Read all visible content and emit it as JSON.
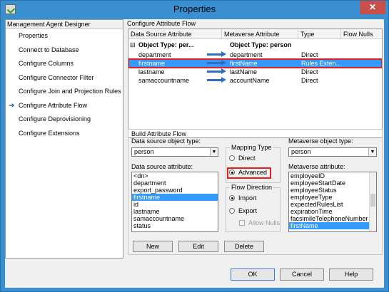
{
  "window": {
    "title": "Properties"
  },
  "nav": {
    "header": "Management Agent Designer",
    "items": [
      {
        "label": "Properties",
        "active": false
      },
      {
        "label": "Connect to Database",
        "active": false
      },
      {
        "label": "Configure Columns",
        "active": false
      },
      {
        "label": "Configure Connector Filter",
        "active": false
      },
      {
        "label": "Configure Join and Projection Rules",
        "active": false
      },
      {
        "label": "Configure Attribute Flow",
        "active": true
      },
      {
        "label": "Configure Deprovisioning",
        "active": false
      },
      {
        "label": "Configure Extensions",
        "active": false
      }
    ]
  },
  "section": {
    "title": "Configure Attribute Flow"
  },
  "grid": {
    "columns": [
      "Data Source Attribute",
      "Metaverse Attribute",
      "Type",
      "Flow Nulls"
    ],
    "group_toggle": "⊟",
    "group_left": "Object Type: per...",
    "group_right": "Object Type: person",
    "rows": [
      {
        "source": "department",
        "metaverse": "department",
        "type": "Direct",
        "selected": false
      },
      {
        "source": "firstname",
        "metaverse": "firstName",
        "type": "Rules Exten...",
        "selected": true
      },
      {
        "source": "lastname",
        "metaverse": "lastName",
        "type": "Direct",
        "selected": false
      },
      {
        "source": "samaccountname",
        "metaverse": "accountName",
        "type": "Direct",
        "selected": false
      }
    ]
  },
  "build": {
    "title": "Build Attribute Flow",
    "ds_object_type_label": "Data source object type:",
    "ds_object_type_value": "person",
    "ds_attribute_label": "Data source attribute:",
    "ds_attributes": [
      "<dn>",
      "department",
      "export_password",
      "firstname",
      "id",
      "lastname",
      "samaccountname",
      "status"
    ],
    "ds_selected": "firstname",
    "mapping_type": {
      "title": "Mapping Type",
      "direct": "Direct",
      "advanced": "Advanced",
      "selected": "Advanced"
    },
    "flow_direction": {
      "title": "Flow Direction",
      "import": "Import",
      "export": "Export",
      "allow_nulls": "Allow Nulls",
      "selected": "Import"
    },
    "mv_object_type_label": "Metaverse object type:",
    "mv_object_type_value": "person",
    "mv_attribute_label": "Metaverse attribute:",
    "mv_attributes": [
      "employeeID",
      "employeeStartDate",
      "employeeStatus",
      "employeeType",
      "expectedRulesList",
      "expirationTime",
      "facsimileTelephoneNumber",
      "firstName"
    ],
    "mv_selected": "firstName",
    "buttons": {
      "new": "New",
      "edit": "Edit",
      "delete": "Delete"
    }
  },
  "footer": {
    "ok": "OK",
    "cancel": "Cancel",
    "help": "Help"
  },
  "icons": {
    "dropdown": "▼",
    "nav_arrow": "➔",
    "close": "✕"
  },
  "colors": {
    "titlebar": "#3a8fd1",
    "selection": "#3399ff",
    "highlight": "#e0201a",
    "close": "#c7504a"
  }
}
